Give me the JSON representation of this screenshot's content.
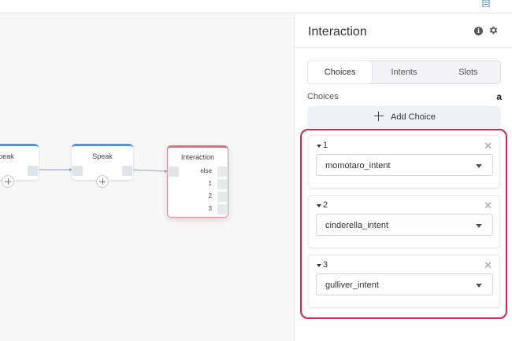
{
  "canvas": {
    "nodes": [
      {
        "title": "Speak"
      },
      {
        "title": "Speak"
      },
      {
        "title": "Interaction",
        "outputs": [
          "else",
          "1",
          "2",
          "3"
        ]
      }
    ]
  },
  "panel": {
    "title": "Interaction",
    "tabs": [
      {
        "label": "Choices",
        "active": true
      },
      {
        "label": "Intents",
        "active": false
      },
      {
        "label": "Slots",
        "active": false
      }
    ],
    "choices_label": "Choices",
    "add_choice_label": "Add Choice",
    "amazon_glyph": "a",
    "choices": [
      {
        "number": "1",
        "intent": "momotaro_intent"
      },
      {
        "number": "2",
        "intent": "cinderella_intent"
      },
      {
        "number": "3",
        "intent": "gulliver_intent"
      }
    ]
  },
  "colors": {
    "speak_accent": "#3d9be9",
    "interaction_accent": "#e46a80",
    "highlight": "#e21f52"
  }
}
